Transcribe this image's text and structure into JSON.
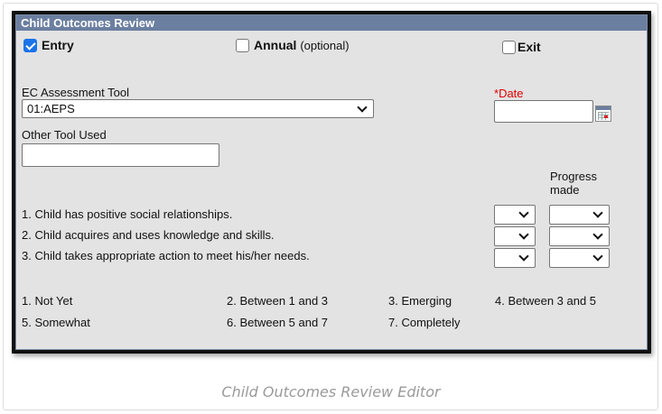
{
  "panel": {
    "title": "Child Outcomes Review",
    "entry": {
      "label": "Entry",
      "checked": true
    },
    "annual": {
      "label": "Annual",
      "note": "(optional)",
      "checked": false
    },
    "exit": {
      "label": "Exit",
      "checked": false
    },
    "assessment_tool": {
      "label": "EC Assessment Tool",
      "value": "01:AEPS"
    },
    "date": {
      "required_mark": "*",
      "label": "Date",
      "value": ""
    },
    "other_tool": {
      "label": "Other Tool Used",
      "value": ""
    },
    "progress_header": "Progress made",
    "outcomes": [
      {
        "text": "1. Child has positive social relationships.",
        "rating": "",
        "progress": ""
      },
      {
        "text": "2. Child acquires and uses knowledge and skills.",
        "rating": "",
        "progress": ""
      },
      {
        "text": "3. Child takes appropriate action to meet his/her needs.",
        "rating": "",
        "progress": ""
      }
    ],
    "legend": [
      "1. Not Yet",
      "2. Between 1 and 3",
      "3. Emerging",
      "4. Between 3 and 5",
      "5. Somewhat",
      "6. Between 5 and 7",
      "7. Completely"
    ]
  },
  "caption": "Child Outcomes Review Editor"
}
